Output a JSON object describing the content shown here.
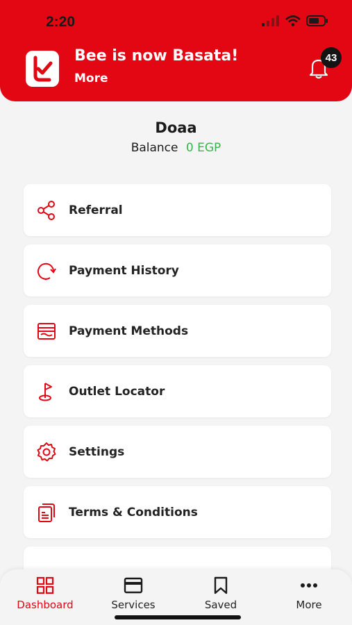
{
  "status_bar": {
    "time": "2:20"
  },
  "header": {
    "title": "Bee is now Basata!",
    "more_label": "More",
    "notification_count": "43",
    "accent_color": "#e30613"
  },
  "user": {
    "name": "Doaa",
    "balance_label": "Balance",
    "balance_value": "0 EGP",
    "balance_color": "#3cb34a"
  },
  "menu": {
    "items": [
      {
        "label": "Referral",
        "icon": "share-icon"
      },
      {
        "label": "Payment History",
        "icon": "history-icon"
      },
      {
        "label": "Payment Methods",
        "icon": "wallet-icon"
      },
      {
        "label": "Outlet Locator",
        "icon": "location-flag-icon"
      },
      {
        "label": "Settings",
        "icon": "gear-icon"
      },
      {
        "label": "Terms & Conditions",
        "icon": "document-icon"
      }
    ]
  },
  "tabbar": {
    "tabs": [
      {
        "label": "Dashboard",
        "icon": "grid-icon",
        "active": true
      },
      {
        "label": "Services",
        "icon": "card-icon",
        "active": false
      },
      {
        "label": "Saved",
        "icon": "bookmark-icon",
        "active": false
      },
      {
        "label": "More",
        "icon": "ellipsis-icon",
        "active": false
      }
    ]
  }
}
